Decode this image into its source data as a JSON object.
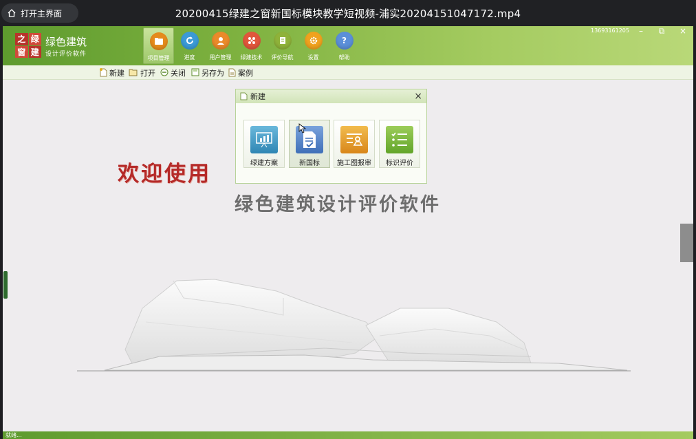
{
  "player": {
    "home_label": "打开主界面",
    "video_title": "20200415绿建之窗新国标模块教学短视频-浦实20204151047172.mp4"
  },
  "app": {
    "logo_chars": [
      "之",
      "绿",
      "窗",
      "建"
    ],
    "brand_title": "绿色建筑",
    "brand_sub": "设计评价软件",
    "phone": "13693161205",
    "nav": [
      {
        "label": "项目管理",
        "icon": "folder-icon",
        "color": "#e58b1c",
        "active": true
      },
      {
        "label": "进度",
        "icon": "refresh-icon",
        "color": "#3b9ad6",
        "active": false
      },
      {
        "label": "用户管理",
        "icon": "user-icon",
        "color": "#ea8a2a",
        "active": false
      },
      {
        "label": "绿建技术",
        "icon": "molecule-icon",
        "color": "#e1573c",
        "active": false
      },
      {
        "label": "评价导航",
        "icon": "book-icon",
        "color": "#8fb23a",
        "active": false
      },
      {
        "label": "设置",
        "icon": "gear-icon",
        "color": "#f0a21e",
        "active": false
      },
      {
        "label": "帮助",
        "icon": "help-icon",
        "color": "#5b8fd8",
        "active": false
      }
    ],
    "toolbar": [
      {
        "label": "新建",
        "icon": "new-doc-icon"
      },
      {
        "label": "打开",
        "icon": "open-folder-icon"
      },
      {
        "label": "关闭",
        "icon": "close-circle-icon"
      },
      {
        "label": "另存为",
        "icon": "save-as-icon"
      },
      {
        "label": "案例",
        "icon": "example-icon"
      }
    ],
    "dialog": {
      "title": "新建",
      "tiles": [
        {
          "label": "绿建方案",
          "icon": "chart-board-icon",
          "color": "#3d9ac6"
        },
        {
          "label": "新国标",
          "icon": "document-check-icon",
          "color": "#4f7fc4"
        },
        {
          "label": "施工图报审",
          "icon": "drawing-review-icon",
          "color": "#e59a1e"
        },
        {
          "label": "标识评价",
          "icon": "checklist-icon",
          "color": "#7ab83a"
        }
      ]
    },
    "welcome": "欢迎使用",
    "software_title": "绿色建筑设计评价软件",
    "status": "就绪..."
  }
}
